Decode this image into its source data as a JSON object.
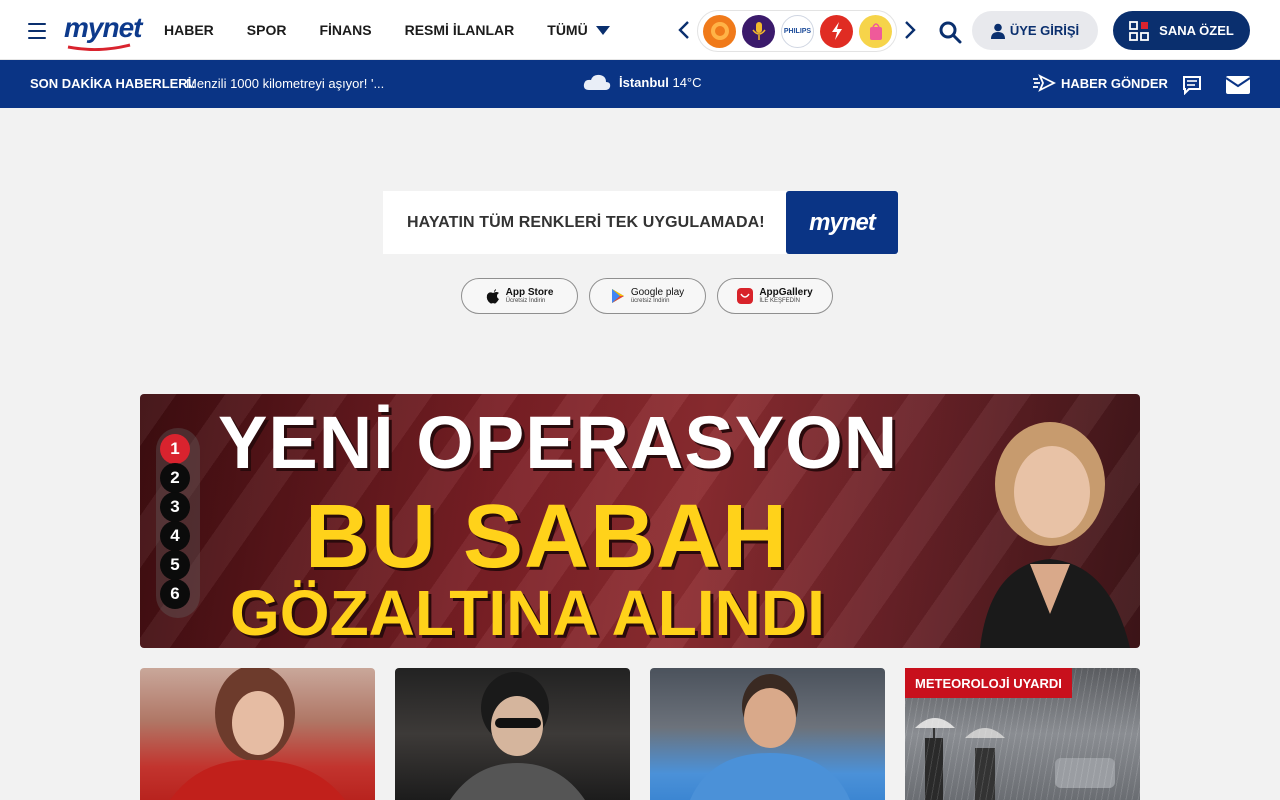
{
  "header": {
    "logo_text": "mynet",
    "nav": [
      {
        "label": "HABER"
      },
      {
        "label": "SPOR"
      },
      {
        "label": "FİNANS"
      },
      {
        "label": "RESMİ İLANLAR"
      },
      {
        "label": "TÜMÜ"
      }
    ],
    "brands": [
      {
        "name": "brand-1",
        "icon": "lion-icon"
      },
      {
        "name": "brand-2",
        "icon": "microphone-icon"
      },
      {
        "name": "philips",
        "label": "PHILIPS"
      },
      {
        "name": "brand-4",
        "icon": "lightning-icon"
      },
      {
        "name": "brand-5",
        "icon": "shopping-bag-icon"
      }
    ],
    "login_label": "ÜYE GİRİŞİ",
    "special_label": "SANA ÖZEL"
  },
  "breaking": {
    "label": "SON DAKİKA HABERLERİ:",
    "text": "Menzili 1000 kilometreyi aşıyor! '...",
    "weather_city": "İstanbul",
    "weather_temp": "14°C",
    "send_news_label": "HABER GÖNDER"
  },
  "promo": {
    "text": "HAYATIN TÜM RENKLERİ TEK UYGULAMADA!",
    "logo_text": "mynet",
    "stores": [
      {
        "main": "App Store",
        "sub": "Ücretsiz İndirin"
      },
      {
        "main": "Google play",
        "sub": "ücretsiz İndirin"
      },
      {
        "main": "AppGallery",
        "sub": "İLE KEŞFEDİN"
      }
    ]
  },
  "hero": {
    "line1": "YENİ OPERASYON",
    "line2": "BU SABAH",
    "line3": "GÖZALTINA ALINDI",
    "pages": [
      "1",
      "2",
      "3",
      "4",
      "5",
      "6"
    ],
    "active_page": "1"
  },
  "cards": [
    {
      "tag": ""
    },
    {
      "tag": ""
    },
    {
      "tag": ""
    },
    {
      "tag": "METEOROLOJİ UYARDI"
    }
  ],
  "colors": {
    "brand_blue": "#0a3485",
    "nav_blue": "#0a2f6e",
    "active_red": "#d9232e",
    "headline_yellow": "#ffd21a"
  }
}
